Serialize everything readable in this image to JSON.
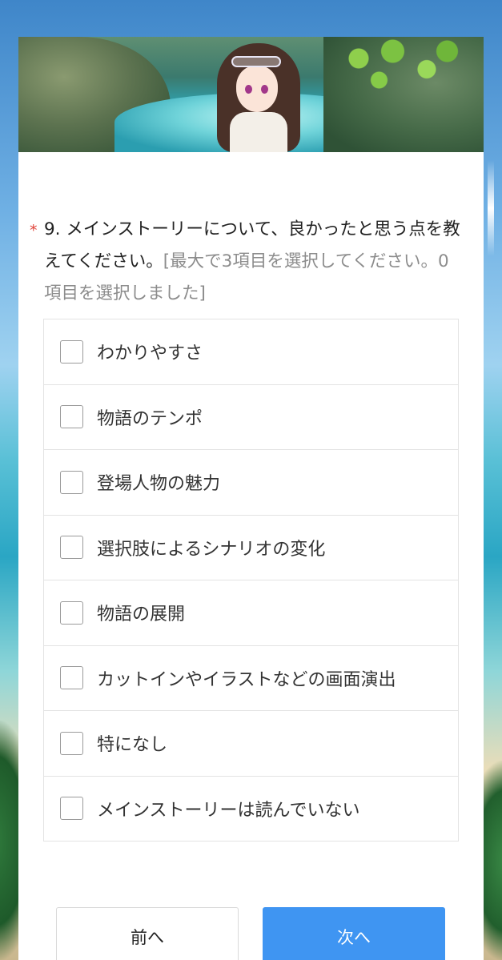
{
  "question": {
    "required_mark": "*",
    "text": "9. メインストーリーについて、良かったと思う点を教えてください。",
    "hint": "[最大で3項目を選択してください。0項目を選択しました]"
  },
  "options": [
    {
      "label": "わかりやすさ",
      "checked": false
    },
    {
      "label": "物語のテンポ",
      "checked": false
    },
    {
      "label": "登場人物の魅力",
      "checked": false
    },
    {
      "label": "選択肢によるシナリオの変化",
      "checked": false
    },
    {
      "label": "物語の展開",
      "checked": false
    },
    {
      "label": "カットインやイラストなどの画面演出",
      "checked": false
    },
    {
      "label": "特になし",
      "checked": false
    },
    {
      "label": "メインストーリーは読んでいない",
      "checked": false
    }
  ],
  "buttons": {
    "prev": "前へ",
    "next": "次へ"
  },
  "colors": {
    "accent": "#3f95f2",
    "required": "#e0443a",
    "hint": "#8c8c8c"
  }
}
